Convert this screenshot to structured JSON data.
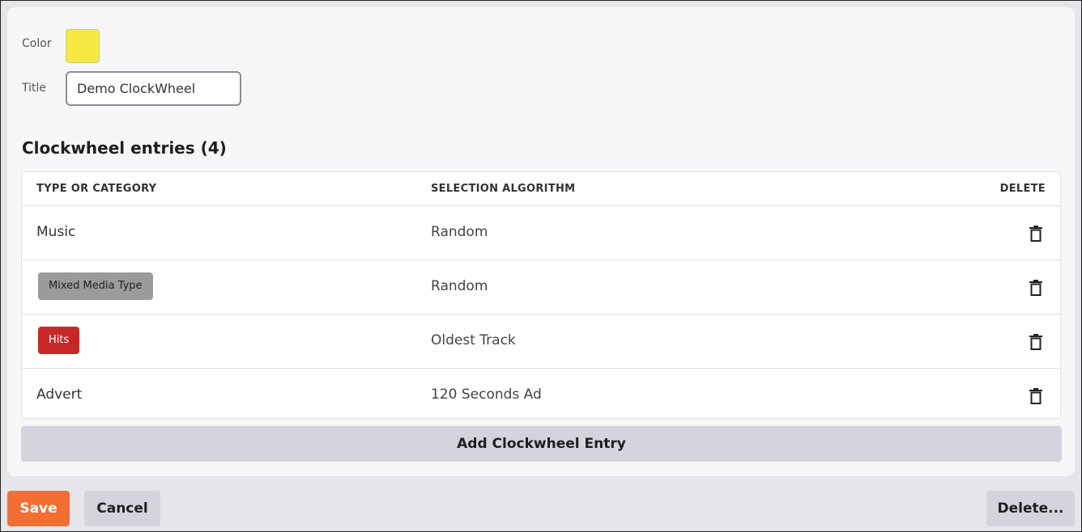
{
  "form": {
    "color_label": "Color",
    "color_value": "#f5e942",
    "title_label": "Title",
    "title_value": "Demo ClockWheel"
  },
  "entries": {
    "heading": "Clockwheel entries (4)",
    "columns": {
      "type": "TYPE OR CATEGORY",
      "algorithm": "SELECTION ALGORITHM",
      "delete": "DELETE"
    },
    "rows": [
      {
        "type": "Music",
        "algorithm": "Random"
      },
      {
        "type": "Mixed Media Type",
        "algorithm": "Random",
        "tag_color": "#9b9b9b"
      },
      {
        "type": "Hits",
        "algorithm": "Oldest Track",
        "tag_color": "#c62828"
      },
      {
        "type": "Advert",
        "algorithm": "120 Seconds Ad"
      }
    ],
    "add_label": "Add Clockwheel Entry"
  },
  "actions": {
    "save": "Save",
    "cancel": "Cancel",
    "delete": "Delete...",
    "save_color": "#f26f33"
  },
  "icons": {
    "row_delete": "trash-icon"
  }
}
